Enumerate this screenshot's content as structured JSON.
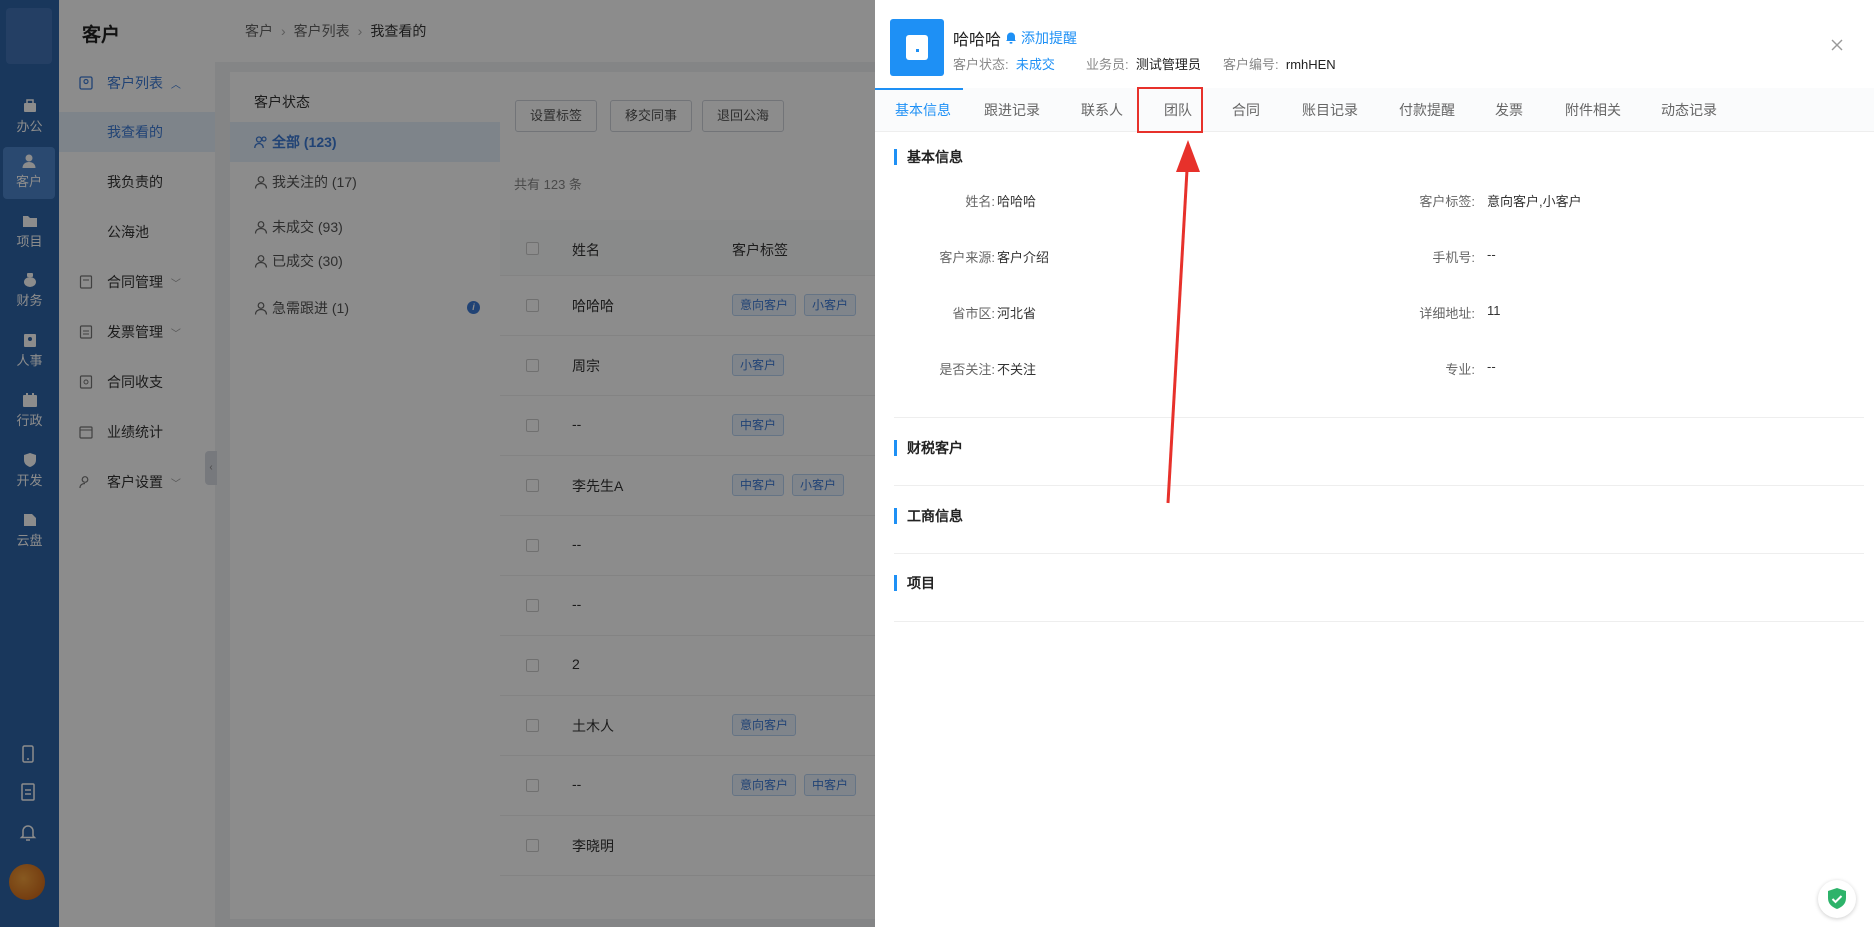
{
  "rail": {
    "items": [
      {
        "label": "办公",
        "icon": "office-icon"
      },
      {
        "label": "客户",
        "icon": "customer-icon"
      },
      {
        "label": "项目",
        "icon": "project-icon"
      },
      {
        "label": "财务",
        "icon": "finance-icon"
      },
      {
        "label": "人事",
        "icon": "hr-icon"
      },
      {
        "label": "行政",
        "icon": "admin-icon"
      },
      {
        "label": "开发",
        "icon": "dev-icon"
      },
      {
        "label": "云盘",
        "icon": "cloud-disk-icon"
      }
    ]
  },
  "sidebar": {
    "title": "客户",
    "items": [
      {
        "label": "客户列表"
      },
      {
        "label": "我查看的"
      },
      {
        "label": "我负责的"
      },
      {
        "label": "公海池"
      },
      {
        "label": "合同管理"
      },
      {
        "label": "发票管理"
      },
      {
        "label": "合同收支"
      },
      {
        "label": "业绩统计"
      },
      {
        "label": "客户设置"
      }
    ]
  },
  "breadcrumb": {
    "items": [
      "客户",
      "客户列表",
      "我查看的"
    ]
  },
  "status_panel": {
    "title": "客户状态",
    "items": [
      {
        "label": "全部 (123)"
      },
      {
        "label": "我关注的 (17)"
      },
      {
        "label": "未成交 (93)"
      },
      {
        "label": "已成交 (30)"
      },
      {
        "label": "急需跟进 (1)"
      }
    ]
  },
  "list": {
    "buttons": [
      "设置标签",
      "移交同事",
      "退回公海"
    ],
    "count": "共有 123 条",
    "columns": [
      "姓名",
      "客户标签"
    ],
    "rows": [
      {
        "name": "哈哈哈",
        "tags": [
          "意向客户",
          "小客户"
        ]
      },
      {
        "name": "周宗",
        "tags": [
          "小客户"
        ]
      },
      {
        "name": "--",
        "tags": [
          "中客户"
        ]
      },
      {
        "name": "李先生A",
        "tags": [
          "中客户",
          "小客户"
        ]
      },
      {
        "name": "--",
        "tags": []
      },
      {
        "name": "--",
        "tags": []
      },
      {
        "name": "2",
        "tags": []
      },
      {
        "name": "土木人",
        "tags": [
          "意向客户"
        ]
      },
      {
        "name": "--",
        "tags": [
          "意向客户",
          "中客户"
        ]
      },
      {
        "name": "李晓明",
        "tags": []
      }
    ]
  },
  "drawer": {
    "name": "哈哈哈",
    "remind": "添加提醒",
    "meta": {
      "status_label": "客户状态:",
      "status_value": "未成交",
      "sales_label": "业务员:",
      "sales_value": "测试管理员",
      "code_label": "客户编号:",
      "code_value": "rmhHEN"
    },
    "tabs": [
      "基本信息",
      "跟进记录",
      "联系人",
      "团队",
      "合同",
      "账目记录",
      "付款提醒",
      "发票",
      "附件相关",
      "动态记录"
    ],
    "sections": {
      "basic": "基本信息",
      "tax": "财税客户",
      "business": "工商信息",
      "project": "项目"
    },
    "fields": [
      {
        "label": "姓名:",
        "value": "哈哈哈"
      },
      {
        "label": "客户标签:",
        "value": "意向客户,小客户"
      },
      {
        "label": "客户来源:",
        "value": "客户介绍"
      },
      {
        "label": "手机号:",
        "value": "--"
      },
      {
        "label": "省市区:",
        "value": "河北省"
      },
      {
        "label": "详细地址:",
        "value": "11"
      },
      {
        "label": "是否关注:",
        "value": "不关注"
      },
      {
        "label": "专业:",
        "value": "--"
      }
    ]
  },
  "colors": {
    "primary": "#1e90f5",
    "rail": "#2f65a8",
    "annotation": "#e7312b"
  }
}
